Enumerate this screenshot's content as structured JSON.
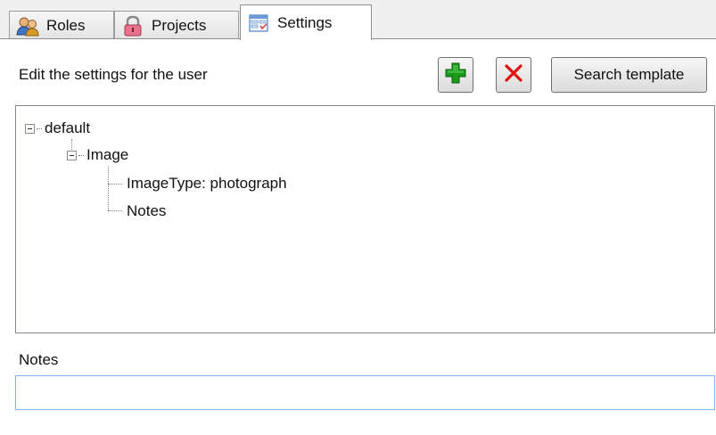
{
  "tabs": [
    {
      "label": "Roles",
      "icon": "users-icon"
    },
    {
      "label": "Projects",
      "icon": "padlock-icon"
    },
    {
      "label": "Settings",
      "icon": "settings-form-icon",
      "active": true
    }
  ],
  "header": {
    "label": "Edit the settings for the user"
  },
  "toolbar": {
    "add_icon": "plus-icon",
    "delete_icon": "red-x-icon",
    "search_template_label": "Search template"
  },
  "tree": {
    "root": "default",
    "child": "Image",
    "leaves": [
      "ImageType: photograph",
      "Notes"
    ]
  },
  "notes": {
    "label": "Notes",
    "value": ""
  },
  "colors": {
    "add": "#1a9a1a",
    "delete": "#e01010",
    "focus_border": "#7eb4ea"
  }
}
